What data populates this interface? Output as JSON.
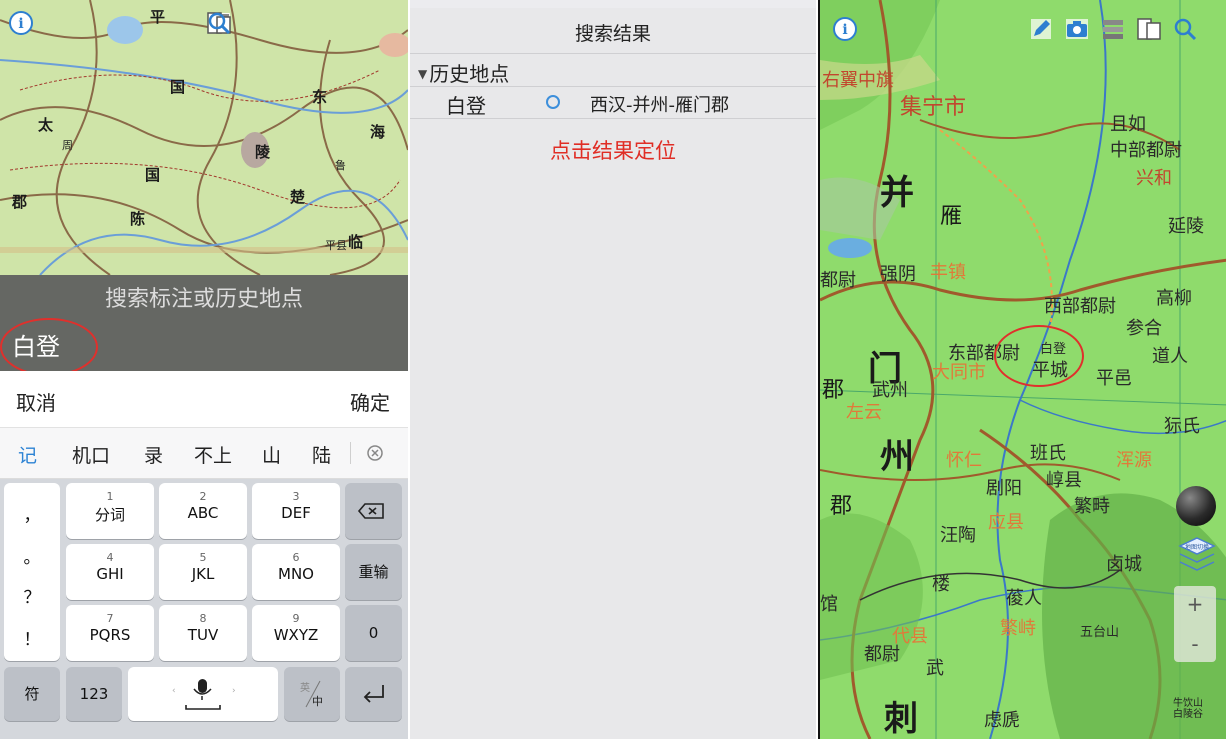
{
  "left_panel": {
    "map_labels": {
      "ping": "平",
      "dong": "东",
      "hai": "海",
      "zhu": "国",
      "gai": "郡",
      "chu": "楚",
      "lin": "临",
      "chen": "陈",
      "tai": "太",
      "zhou": "周",
      "chen2": "平县",
      "linzi": "陵",
      "lu": "鲁",
      "guo": "国"
    },
    "search": {
      "placeholder": "搜索标注或历史地点",
      "value": "白登"
    },
    "actions": {
      "cancel": "取消",
      "confirm": "确定"
    },
    "candidates": [
      "记",
      "机口",
      "录",
      "不上",
      "山",
      "陆"
    ],
    "keyboard": {
      "symbols": [
        "，",
        "。",
        "？",
        "！"
      ],
      "keys": [
        {
          "num": "1",
          "letters": "分词"
        },
        {
          "num": "2",
          "letters": "ABC"
        },
        {
          "num": "3",
          "letters": "DEF"
        },
        {
          "num": "4",
          "letters": "GHI"
        },
        {
          "num": "5",
          "letters": "JKL"
        },
        {
          "num": "6",
          "letters": "MNO"
        },
        {
          "num": "7",
          "letters": "PQRS"
        },
        {
          "num": "8",
          "letters": "TUV"
        },
        {
          "num": "9",
          "letters": "WXYZ"
        }
      ],
      "retype": "重输",
      "zero": "0",
      "fu": "符",
      "num123": "123",
      "lang_top": "英",
      "lang_bottom": "中"
    }
  },
  "middle_panel": {
    "title": "搜索结果",
    "section": "历史地点",
    "result": {
      "name": "白登",
      "location": "西汉-并州-雁门郡"
    },
    "hint": "点击结果定位"
  },
  "right_panel": {
    "labels": {
      "zhongqi": "右翼中旗",
      "jining": "集宁市",
      "qieru": "且如",
      "zhongbu": "中部都尉",
      "xinghe": "兴和",
      "bing": "并",
      "yan": "雁",
      "yanling": "延陵",
      "qiangyin": "强阴",
      "fengzhen": "丰镇",
      "dubu": "都尉",
      "xibu": "西部都尉",
      "gaoliu": "高柳",
      "canhe": "参合",
      "daoren": "道人",
      "dongbu": "东部都尉",
      "baideng": "白登",
      "pingcheng": "平城",
      "pingyi": "平邑",
      "men": "门",
      "wuzhou": "武州",
      "jun": "郡",
      "datong": "大同市",
      "zuoyun": "左云",
      "zhou": "州",
      "huairen": "怀仁",
      "banshi": "班氏",
      "shi": "狋氏",
      "hunyuan": "浑源",
      "chuyang": "剧阳",
      "chunxian": "崞县",
      "jun2": "郡",
      "yingxian": "应县",
      "fanzhi": "繁畤",
      "wangtao": "汪陶",
      "lucheng": "卤城",
      "lou": "楼",
      "fanren": "葰人",
      "daixian": "代县",
      "fanzhi2": "繁峙",
      "wutai": "五台山",
      "dubu2": "都尉",
      "wu": "武",
      "ci": "刺",
      "lutuo": "虑虒",
      "guan": "馆",
      "niuyin": "牛饮山",
      "bailing": "白陵谷",
      "lantern": "地图切换"
    },
    "zoom_in": "+",
    "zoom_out": "-"
  }
}
